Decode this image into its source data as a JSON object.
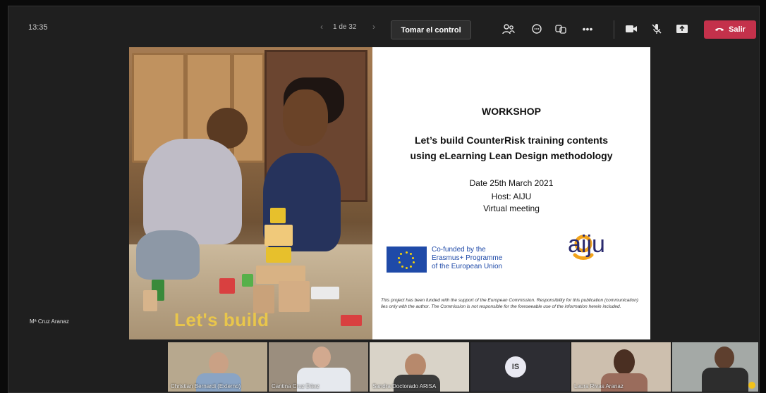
{
  "meeting": {
    "clock": "13:35",
    "page_indicator": "1 de 32",
    "take_control_label": "Tomar el control",
    "leave_label": "Salir",
    "presenter_name": "Mª Cruz Aranaz"
  },
  "toolbar_icons": [
    "people-icon",
    "chat-icon",
    "reactions-icon",
    "more-icon",
    "camera-icon",
    "mic-off-icon",
    "share-icon",
    "phone-icon"
  ],
  "slide": {
    "photo_caption": "Let's build",
    "workshop": "WORKSHOP",
    "title_line1": "Let’s build CounterRisk training contents",
    "title_line2": "using eLearning Lean Design methodology",
    "date": "Date 25th March 2021",
    "host": "Host: AIJU",
    "venue": "Virtual meeting",
    "eu_line1": "Co-funded by the",
    "eu_line2": "Erasmus+ Programme",
    "eu_line3": "of the European Union",
    "aiju_logo": "aiju",
    "disclaimer": "This project has been funded with the support of the European Commission. Responsibility for this publication (communication) lies only with the author. The Commission is not responsible for the foreseeable use of the information herein included."
  },
  "participants": [
    {
      "name": "Christian Bernardi (Externo)"
    },
    {
      "name": "Cantina Cruz Dáez"
    },
    {
      "name": "Sandra Doctorado ARiSA"
    },
    {
      "initials": "IS"
    },
    {
      "name": "Laura Rivas Aranaz"
    },
    {
      "name": ""
    }
  ],
  "colors": {
    "leave_button": "#c4314b",
    "eu_blue": "#1f4aa8",
    "aiju_orange": "#f2a31b"
  }
}
